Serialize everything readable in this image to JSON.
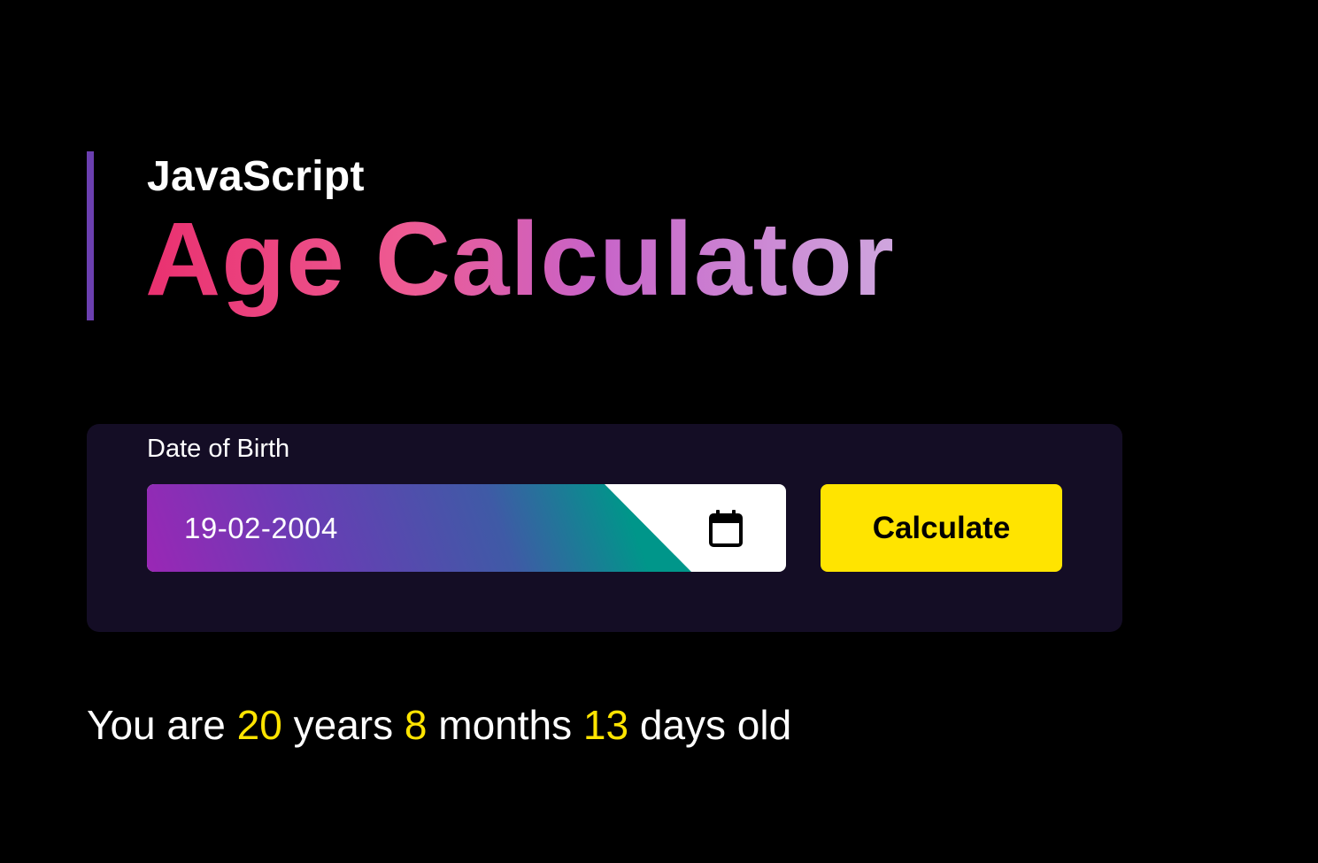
{
  "header": {
    "subtitle": "JavaScript",
    "title": "Age Calculator"
  },
  "form": {
    "dob_label": "Date of Birth",
    "dob_value": "19-02-2004",
    "calendar_icon": "calendar-icon",
    "calculate_label": "Calculate"
  },
  "result": {
    "prefix": "You are",
    "years": "20",
    "years_label": "years",
    "months": "8",
    "months_label": "months",
    "days": "13",
    "days_label": "days old"
  },
  "colors": {
    "background": "#000000",
    "card": "#140d25",
    "accent_yellow": "#ffe400",
    "heading_bar": "#6b3fb0",
    "title_gradient_start": "#e9306f",
    "title_gradient_end": "#cfa6de"
  }
}
